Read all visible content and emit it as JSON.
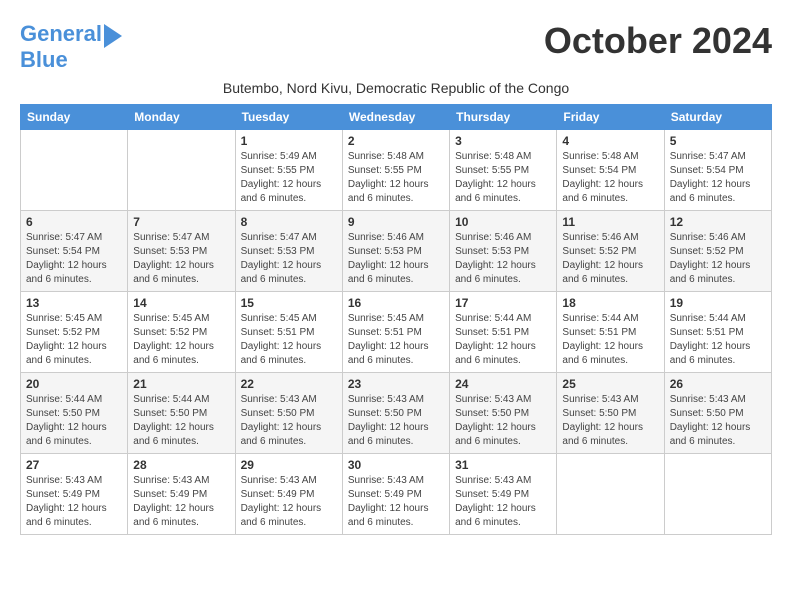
{
  "logo": {
    "line1": "General",
    "line2": "Blue"
  },
  "title": "October 2024",
  "subtitle": "Butembo, Nord Kivu, Democratic Republic of the Congo",
  "weekdays": [
    "Sunday",
    "Monday",
    "Tuesday",
    "Wednesday",
    "Thursday",
    "Friday",
    "Saturday"
  ],
  "weeks": [
    [
      {
        "day": "",
        "sunrise": "",
        "sunset": "",
        "daylight": ""
      },
      {
        "day": "",
        "sunrise": "",
        "sunset": "",
        "daylight": ""
      },
      {
        "day": "1",
        "sunrise": "Sunrise: 5:49 AM",
        "sunset": "Sunset: 5:55 PM",
        "daylight": "Daylight: 12 hours and 6 minutes."
      },
      {
        "day": "2",
        "sunrise": "Sunrise: 5:48 AM",
        "sunset": "Sunset: 5:55 PM",
        "daylight": "Daylight: 12 hours and 6 minutes."
      },
      {
        "day": "3",
        "sunrise": "Sunrise: 5:48 AM",
        "sunset": "Sunset: 5:55 PM",
        "daylight": "Daylight: 12 hours and 6 minutes."
      },
      {
        "day": "4",
        "sunrise": "Sunrise: 5:48 AM",
        "sunset": "Sunset: 5:54 PM",
        "daylight": "Daylight: 12 hours and 6 minutes."
      },
      {
        "day": "5",
        "sunrise": "Sunrise: 5:47 AM",
        "sunset": "Sunset: 5:54 PM",
        "daylight": "Daylight: 12 hours and 6 minutes."
      }
    ],
    [
      {
        "day": "6",
        "sunrise": "Sunrise: 5:47 AM",
        "sunset": "Sunset: 5:54 PM",
        "daylight": "Daylight: 12 hours and 6 minutes."
      },
      {
        "day": "7",
        "sunrise": "Sunrise: 5:47 AM",
        "sunset": "Sunset: 5:53 PM",
        "daylight": "Daylight: 12 hours and 6 minutes."
      },
      {
        "day": "8",
        "sunrise": "Sunrise: 5:47 AM",
        "sunset": "Sunset: 5:53 PM",
        "daylight": "Daylight: 12 hours and 6 minutes."
      },
      {
        "day": "9",
        "sunrise": "Sunrise: 5:46 AM",
        "sunset": "Sunset: 5:53 PM",
        "daylight": "Daylight: 12 hours and 6 minutes."
      },
      {
        "day": "10",
        "sunrise": "Sunrise: 5:46 AM",
        "sunset": "Sunset: 5:53 PM",
        "daylight": "Daylight: 12 hours and 6 minutes."
      },
      {
        "day": "11",
        "sunrise": "Sunrise: 5:46 AM",
        "sunset": "Sunset: 5:52 PM",
        "daylight": "Daylight: 12 hours and 6 minutes."
      },
      {
        "day": "12",
        "sunrise": "Sunrise: 5:46 AM",
        "sunset": "Sunset: 5:52 PM",
        "daylight": "Daylight: 12 hours and 6 minutes."
      }
    ],
    [
      {
        "day": "13",
        "sunrise": "Sunrise: 5:45 AM",
        "sunset": "Sunset: 5:52 PM",
        "daylight": "Daylight: 12 hours and 6 minutes."
      },
      {
        "day": "14",
        "sunrise": "Sunrise: 5:45 AM",
        "sunset": "Sunset: 5:52 PM",
        "daylight": "Daylight: 12 hours and 6 minutes."
      },
      {
        "day": "15",
        "sunrise": "Sunrise: 5:45 AM",
        "sunset": "Sunset: 5:51 PM",
        "daylight": "Daylight: 12 hours and 6 minutes."
      },
      {
        "day": "16",
        "sunrise": "Sunrise: 5:45 AM",
        "sunset": "Sunset: 5:51 PM",
        "daylight": "Daylight: 12 hours and 6 minutes."
      },
      {
        "day": "17",
        "sunrise": "Sunrise: 5:44 AM",
        "sunset": "Sunset: 5:51 PM",
        "daylight": "Daylight: 12 hours and 6 minutes."
      },
      {
        "day": "18",
        "sunrise": "Sunrise: 5:44 AM",
        "sunset": "Sunset: 5:51 PM",
        "daylight": "Daylight: 12 hours and 6 minutes."
      },
      {
        "day": "19",
        "sunrise": "Sunrise: 5:44 AM",
        "sunset": "Sunset: 5:51 PM",
        "daylight": "Daylight: 12 hours and 6 minutes."
      }
    ],
    [
      {
        "day": "20",
        "sunrise": "Sunrise: 5:44 AM",
        "sunset": "Sunset: 5:50 PM",
        "daylight": "Daylight: 12 hours and 6 minutes."
      },
      {
        "day": "21",
        "sunrise": "Sunrise: 5:44 AM",
        "sunset": "Sunset: 5:50 PM",
        "daylight": "Daylight: 12 hours and 6 minutes."
      },
      {
        "day": "22",
        "sunrise": "Sunrise: 5:43 AM",
        "sunset": "Sunset: 5:50 PM",
        "daylight": "Daylight: 12 hours and 6 minutes."
      },
      {
        "day": "23",
        "sunrise": "Sunrise: 5:43 AM",
        "sunset": "Sunset: 5:50 PM",
        "daylight": "Daylight: 12 hours and 6 minutes."
      },
      {
        "day": "24",
        "sunrise": "Sunrise: 5:43 AM",
        "sunset": "Sunset: 5:50 PM",
        "daylight": "Daylight: 12 hours and 6 minutes."
      },
      {
        "day": "25",
        "sunrise": "Sunrise: 5:43 AM",
        "sunset": "Sunset: 5:50 PM",
        "daylight": "Daylight: 12 hours and 6 minutes."
      },
      {
        "day": "26",
        "sunrise": "Sunrise: 5:43 AM",
        "sunset": "Sunset: 5:50 PM",
        "daylight": "Daylight: 12 hours and 6 minutes."
      }
    ],
    [
      {
        "day": "27",
        "sunrise": "Sunrise: 5:43 AM",
        "sunset": "Sunset: 5:49 PM",
        "daylight": "Daylight: 12 hours and 6 minutes."
      },
      {
        "day": "28",
        "sunrise": "Sunrise: 5:43 AM",
        "sunset": "Sunset: 5:49 PM",
        "daylight": "Daylight: 12 hours and 6 minutes."
      },
      {
        "day": "29",
        "sunrise": "Sunrise: 5:43 AM",
        "sunset": "Sunset: 5:49 PM",
        "daylight": "Daylight: 12 hours and 6 minutes."
      },
      {
        "day": "30",
        "sunrise": "Sunrise: 5:43 AM",
        "sunset": "Sunset: 5:49 PM",
        "daylight": "Daylight: 12 hours and 6 minutes."
      },
      {
        "day": "31",
        "sunrise": "Sunrise: 5:43 AM",
        "sunset": "Sunset: 5:49 PM",
        "daylight": "Daylight: 12 hours and 6 minutes."
      },
      {
        "day": "",
        "sunrise": "",
        "sunset": "",
        "daylight": ""
      },
      {
        "day": "",
        "sunrise": "",
        "sunset": "",
        "daylight": ""
      }
    ]
  ]
}
